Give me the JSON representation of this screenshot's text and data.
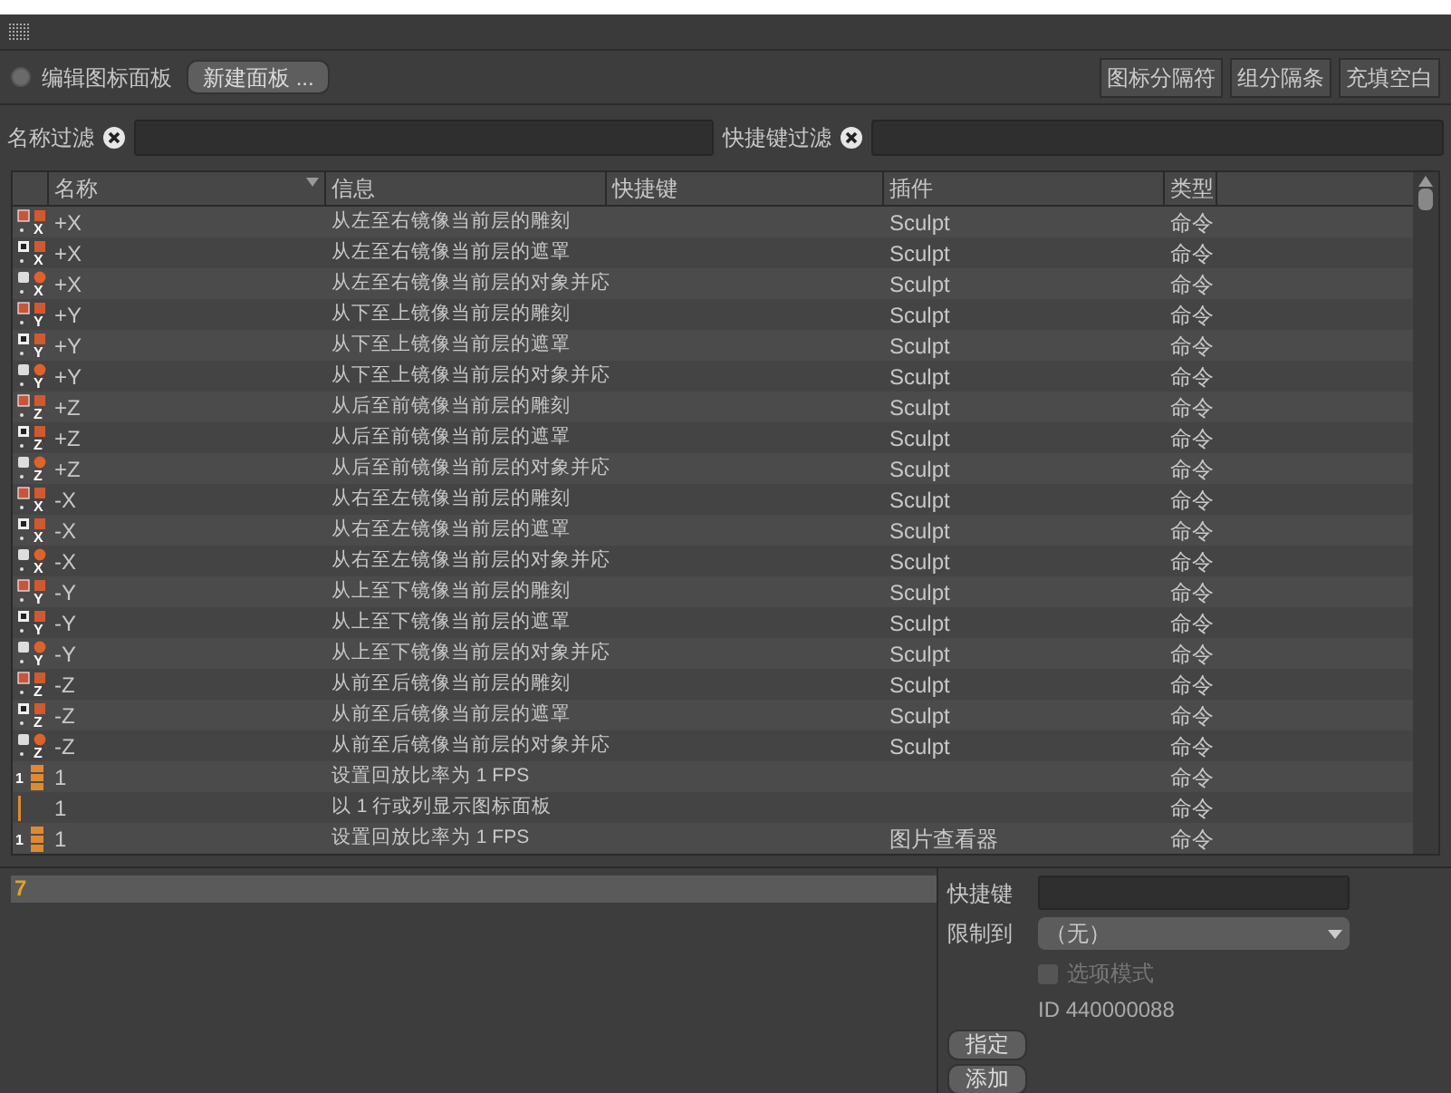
{
  "toolbar": {
    "edit_palette": {
      "label": "编辑图标面板",
      "checked": false
    },
    "new_palette": "新建面板 ...",
    "buttons": [
      "图标分隔符",
      "组分隔条",
      "充填空白"
    ]
  },
  "filters": [
    {
      "label": "名称过滤"
    },
    {
      "label": "快捷键过滤"
    }
  ],
  "table": {
    "columns": [
      "名称",
      "信息",
      "快捷键",
      "插件",
      "类型"
    ],
    "rows": [
      {
        "icon": {
          "kind": "sculpt",
          "label": "X"
        },
        "name": "+X",
        "info": "从左至右镜像当前层的雕刻",
        "plugin": "Sculpt",
        "type": "命令"
      },
      {
        "icon": {
          "kind": "mask",
          "label": "X"
        },
        "name": "+X",
        "info": "从左至右镜像当前层的遮罩",
        "plugin": "Sculpt",
        "type": "命令"
      },
      {
        "icon": {
          "kind": "object",
          "label": "X"
        },
        "name": "+X",
        "info": "从左至右镜像当前层的对象并応",
        "plugin": "Sculpt",
        "type": "命令"
      },
      {
        "icon": {
          "kind": "sculpt",
          "label": "Y"
        },
        "name": "+Y",
        "info": "从下至上镜像当前层的雕刻",
        "plugin": "Sculpt",
        "type": "命令"
      },
      {
        "icon": {
          "kind": "mask",
          "label": "Y"
        },
        "name": "+Y",
        "info": "从下至上镜像当前层的遮罩",
        "plugin": "Sculpt",
        "type": "命令"
      },
      {
        "icon": {
          "kind": "object",
          "label": "Y"
        },
        "name": "+Y",
        "info": "从下至上镜像当前层的对象并応",
        "plugin": "Sculpt",
        "type": "命令"
      },
      {
        "icon": {
          "kind": "sculpt",
          "label": "Z"
        },
        "name": "+Z",
        "info": "从后至前镜像当前层的雕刻",
        "plugin": "Sculpt",
        "type": "命令"
      },
      {
        "icon": {
          "kind": "mask",
          "label": "Z"
        },
        "name": "+Z",
        "info": "从后至前镜像当前层的遮罩",
        "plugin": "Sculpt",
        "type": "命令"
      },
      {
        "icon": {
          "kind": "object",
          "label": "Z"
        },
        "name": "+Z",
        "info": "从后至前镜像当前层的对象并応",
        "plugin": "Sculpt",
        "type": "命令"
      },
      {
        "icon": {
          "kind": "sculpt",
          "label": "X"
        },
        "name": "-X",
        "info": "从右至左镜像当前层的雕刻",
        "plugin": "Sculpt",
        "type": "命令"
      },
      {
        "icon": {
          "kind": "mask",
          "label": "X"
        },
        "name": "-X",
        "info": "从右至左镜像当前层的遮罩",
        "plugin": "Sculpt",
        "type": "命令"
      },
      {
        "icon": {
          "kind": "object",
          "label": "X"
        },
        "name": "-X",
        "info": "从右至左镜像当前层的对象并応",
        "plugin": "Sculpt",
        "type": "命令"
      },
      {
        "icon": {
          "kind": "sculpt",
          "label": "Y"
        },
        "name": "-Y",
        "info": "从上至下镜像当前层的雕刻",
        "plugin": "Sculpt",
        "type": "命令"
      },
      {
        "icon": {
          "kind": "mask",
          "label": "Y"
        },
        "name": "-Y",
        "info": "从上至下镜像当前层的遮罩",
        "plugin": "Sculpt",
        "type": "命令"
      },
      {
        "icon": {
          "kind": "object",
          "label": "Y"
        },
        "name": "-Y",
        "info": "从上至下镜像当前层的对象并応",
        "plugin": "Sculpt",
        "type": "命令"
      },
      {
        "icon": {
          "kind": "sculpt",
          "label": "Z"
        },
        "name": "-Z",
        "info": "从前至后镜像当前层的雕刻",
        "plugin": "Sculpt",
        "type": "命令"
      },
      {
        "icon": {
          "kind": "mask",
          "label": "Z"
        },
        "name": "-Z",
        "info": "从前至后镜像当前层的遮罩",
        "plugin": "Sculpt",
        "type": "命令"
      },
      {
        "icon": {
          "kind": "object",
          "label": "Z"
        },
        "name": "-Z",
        "info": "从前至后镜像当前层的对象并応",
        "plugin": "Sculpt",
        "type": "命令"
      },
      {
        "icon": {
          "kind": "fps",
          "label": "1"
        },
        "name": "1",
        "info": "设置回放比率为 1 FPS",
        "type": "命令"
      },
      {
        "icon": {
          "kind": "layout"
        },
        "name": "1",
        "info": "以 1 行或列显示图标面板",
        "type": "命令"
      },
      {
        "icon": {
          "kind": "fps",
          "label": "1"
        },
        "name": "1",
        "info": "设置回放比率为 1 FPS",
        "plugin": "图片查看器",
        "type": "命令"
      }
    ]
  },
  "bottom": {
    "selected_item": "7",
    "shortcut_label": "快捷键",
    "restrict_label": "限制到",
    "restrict_value": "（无）",
    "option_mode": {
      "label": "选项模式",
      "checked": false,
      "disabled": true
    },
    "id": "ID 440000088",
    "buttons": [
      "指定",
      "添加"
    ]
  }
}
